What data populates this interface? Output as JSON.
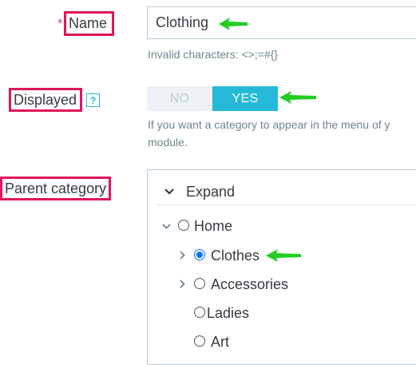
{
  "form": {
    "name": {
      "required_mark": "*",
      "label": "Name",
      "value": "Clothing",
      "hint": "Invalid characters: <>;=#{}"
    },
    "displayed": {
      "label": "Displayed",
      "help_glyph": "?",
      "options": [
        "NO",
        "YES"
      ],
      "selected": "YES",
      "hint_line1": "If you want a category to appear in the menu of y",
      "hint_line2": "module."
    },
    "parent_category": {
      "label": "Parent category",
      "expand_label": "Expand",
      "tree": [
        {
          "label": "Home",
          "expanded": true,
          "selected": false
        },
        {
          "label": "Clothes",
          "expandable": true,
          "selected": true
        },
        {
          "label": "Accessories",
          "expandable": true,
          "selected": false
        },
        {
          "label": "Ladies",
          "selected": false
        },
        {
          "label": "Art",
          "selected": false
        }
      ]
    }
  },
  "colors": {
    "accent": "#25b9d7",
    "annotation_box": "#e0145f",
    "annotation_arrow": "#22cc22",
    "radio_selected": "#0075ff"
  }
}
